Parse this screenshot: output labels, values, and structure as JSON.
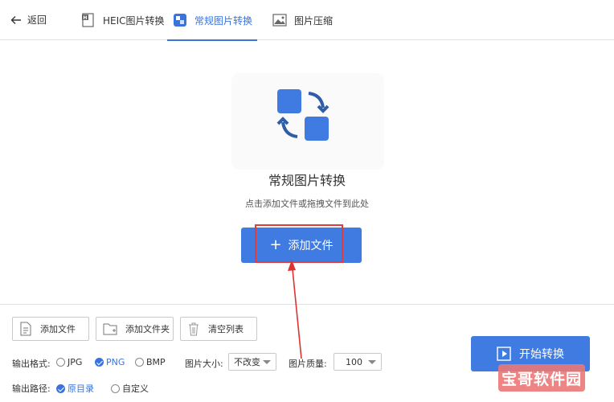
{
  "topbar": {
    "back_label": "返回",
    "tabs": [
      {
        "label": "HEIC图片转换",
        "icon": "heic-file-icon",
        "active": false
      },
      {
        "label": "常规图片转换",
        "icon": "convert-icon",
        "active": true
      },
      {
        "label": "图片压缩",
        "icon": "image-compress-icon",
        "active": false
      }
    ]
  },
  "dropzone": {
    "title": "常规图片转换",
    "hint": "点击添加文件或拖拽文件到此处",
    "add_button": "添加文件"
  },
  "toolbar": {
    "add_file": "添加文件",
    "add_folder": "添加文件夹",
    "clear_list": "清空列表"
  },
  "options": {
    "format_label": "输出格式:",
    "formats": [
      {
        "label": "JPG",
        "checked": false
      },
      {
        "label": "PNG",
        "checked": true
      },
      {
        "label": "BMP",
        "checked": false
      }
    ],
    "size_label": "图片大小:",
    "size_value": "不改变",
    "quality_label": "图片质量:",
    "quality_value": "100",
    "path_label": "输出路径:",
    "paths": [
      {
        "label": "原目录",
        "checked": true
      },
      {
        "label": "自定义",
        "checked": false
      }
    ]
  },
  "start_button": "开始转换",
  "watermark": "宝哥软件园",
  "colors": {
    "accent": "#3f7be0",
    "highlight": "#e53a3a"
  }
}
